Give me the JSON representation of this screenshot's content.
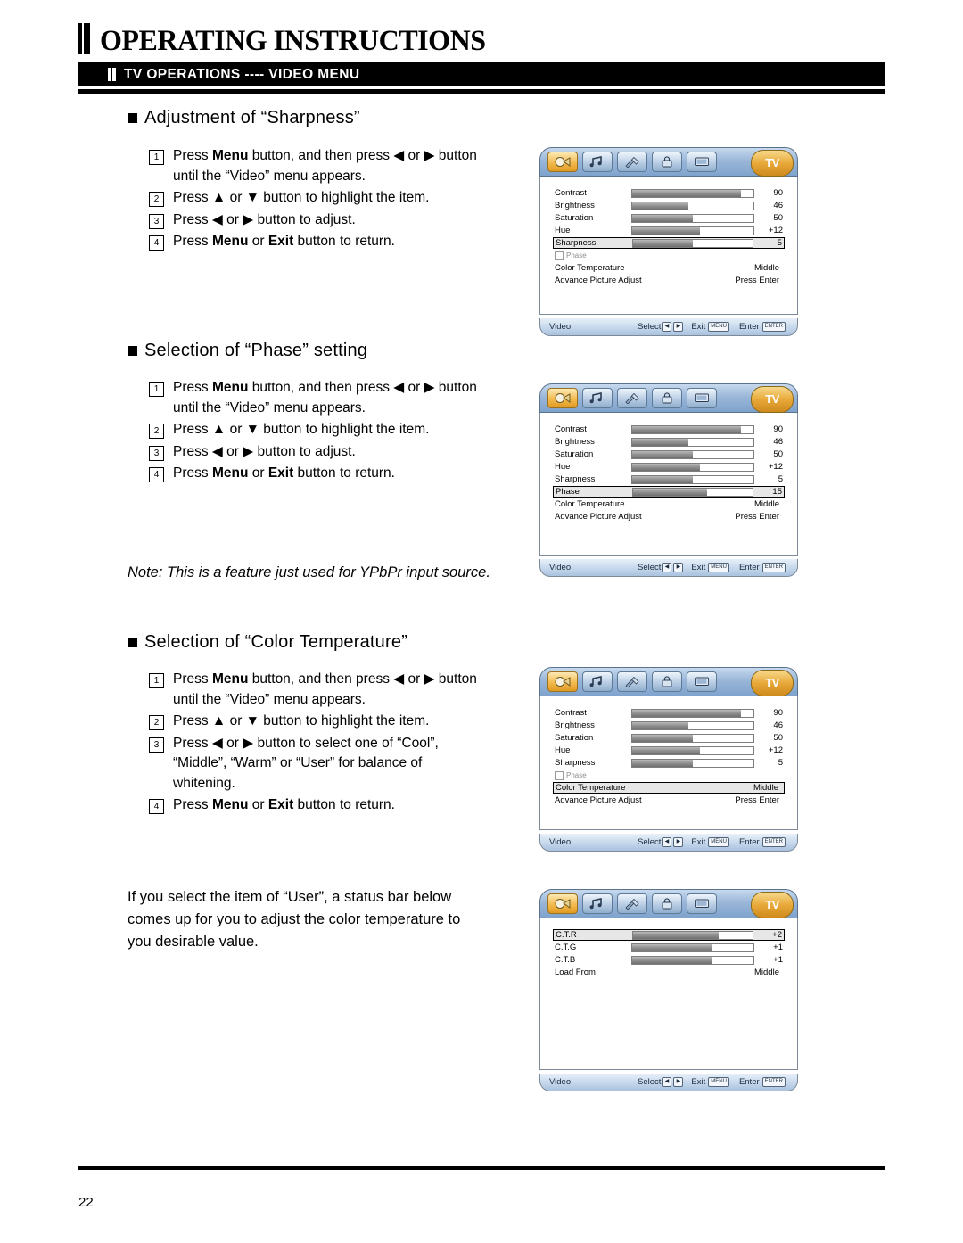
{
  "header": {
    "title": "OPERATING INSTRUCTIONS",
    "subtitle": "TV OPERATIONS ---- VIDEO MENU"
  },
  "sections": [
    {
      "heading": "Adjustment of “Sharpness”",
      "steps": [
        {
          "num": "1",
          "html": "Press <b>Menu</b> button, and then press ◀ or ▶ button until the “Video” menu appears."
        },
        {
          "num": "2",
          "html": "Press ▲ or ▼ button to highlight the item."
        },
        {
          "num": "3",
          "html": "Press ◀ or ▶ button to adjust."
        },
        {
          "num": "4",
          "html": "Press <b>Menu</b> or <b>Exit</b> button to return."
        }
      ]
    },
    {
      "heading": "Selection of “Phase” setting",
      "steps": [
        {
          "num": "1",
          "html": "Press <b>Menu</b> button, and then press ◀ or ▶ button until the “Video” menu appears."
        },
        {
          "num": "2",
          "html": "Press ▲ or ▼ button to highlight the item."
        },
        {
          "num": "3",
          "html": "Press ◀ or ▶ button to adjust."
        },
        {
          "num": "4",
          "html": "Press <b>Menu</b> or <b>Exit</b> button to return."
        }
      ]
    },
    {
      "heading": "Selection of “Color Temperature”",
      "steps": [
        {
          "num": "1",
          "html": "Press <b>Menu</b> button, and then press ◀ or ▶ button until the “Video” menu appears."
        },
        {
          "num": "2",
          "html": "Press ▲ or ▼ button to highlight the item."
        },
        {
          "num": "3",
          "html": "Press ◀ or ▶ button to select one of “Cool”, “Middle”, “Warm” or “User” for balance of whitening."
        },
        {
          "num": "4",
          "html": "Press <b>Menu</b> or <b>Exit</b> button to return."
        }
      ]
    }
  ],
  "note": "Note: This is a feature just used for YPbPr input source.",
  "paragraph": "If you select the item of “User”, a status bar below comes up for you to adjust the color temperature to you desirable value.",
  "osd_footer": {
    "menu_label": "Video",
    "select_label": "Select",
    "exit_label": "Exit",
    "exit_key": "MENU",
    "enter_label": "Enter",
    "enter_key": "ENTER"
  },
  "osd_panels": [
    {
      "name": "sharpness-menu",
      "rows": [
        {
          "type": "bar",
          "label": "Contrast",
          "value": "90",
          "pct": 90
        },
        {
          "type": "bar",
          "label": "Brightness",
          "value": "46",
          "pct": 46
        },
        {
          "type": "bar",
          "label": "Saturation",
          "value": "50",
          "pct": 50
        },
        {
          "type": "bar",
          "label": "Hue",
          "value": "+12",
          "pct": 56
        },
        {
          "type": "bar",
          "label": "Sharpness",
          "value": "5",
          "pct": 50,
          "highlight": true
        },
        {
          "type": "chip",
          "label": "Phase"
        },
        {
          "type": "text",
          "label": "Color Temperature",
          "value": "Middle"
        },
        {
          "type": "text",
          "label": "Advance Picture Adjust",
          "value": "Press Enter"
        }
      ]
    },
    {
      "name": "phase-menu",
      "rows": [
        {
          "type": "bar",
          "label": "Contrast",
          "value": "90",
          "pct": 90
        },
        {
          "type": "bar",
          "label": "Brightness",
          "value": "46",
          "pct": 46
        },
        {
          "type": "bar",
          "label": "Saturation",
          "value": "50",
          "pct": 50
        },
        {
          "type": "bar",
          "label": "Hue",
          "value": "+12",
          "pct": 56
        },
        {
          "type": "bar",
          "label": "Sharpness",
          "value": "5",
          "pct": 50
        },
        {
          "type": "bar",
          "label": "Phase",
          "value": "15",
          "pct": 62,
          "highlight": true
        },
        {
          "type": "text",
          "label": "Color Temperature",
          "value": "Middle"
        },
        {
          "type": "text",
          "label": "Advance Picture Adjust",
          "value": "Press Enter"
        }
      ]
    },
    {
      "name": "color-temperature-menu",
      "rows": [
        {
          "type": "bar",
          "label": "Contrast",
          "value": "90",
          "pct": 90
        },
        {
          "type": "bar",
          "label": "Brightness",
          "value": "46",
          "pct": 46
        },
        {
          "type": "bar",
          "label": "Saturation",
          "value": "50",
          "pct": 50
        },
        {
          "type": "bar",
          "label": "Hue",
          "value": "+12",
          "pct": 56
        },
        {
          "type": "bar",
          "label": "Sharpness",
          "value": "5",
          "pct": 50
        },
        {
          "type": "chip",
          "label": "Phase"
        },
        {
          "type": "text",
          "label": "Color Temperature",
          "value": "Middle",
          "highlight": true
        },
        {
          "type": "text",
          "label": "Advance Picture Adjust",
          "value": "Press Enter"
        }
      ]
    },
    {
      "name": "user-color-status-bar",
      "rows": [
        {
          "type": "bar",
          "label": "C.T.R",
          "value": "+2",
          "pct": 72,
          "highlight": true
        },
        {
          "type": "bar",
          "label": "C.T.G",
          "value": "+1",
          "pct": 66
        },
        {
          "type": "bar",
          "label": "C.T.B",
          "value": "+1",
          "pct": 66
        },
        {
          "type": "text",
          "label": "Load From",
          "value": "Middle"
        }
      ]
    }
  ],
  "osd_tabs": [
    {
      "icon": "picture-icon",
      "selected": true
    },
    {
      "icon": "audio-icon",
      "selected": false
    },
    {
      "icon": "setup-icon",
      "selected": false
    },
    {
      "icon": "lock-icon",
      "selected": false
    },
    {
      "icon": "screen-icon",
      "selected": false
    }
  ],
  "osd_tv_badge": "TV",
  "page_number": "22"
}
